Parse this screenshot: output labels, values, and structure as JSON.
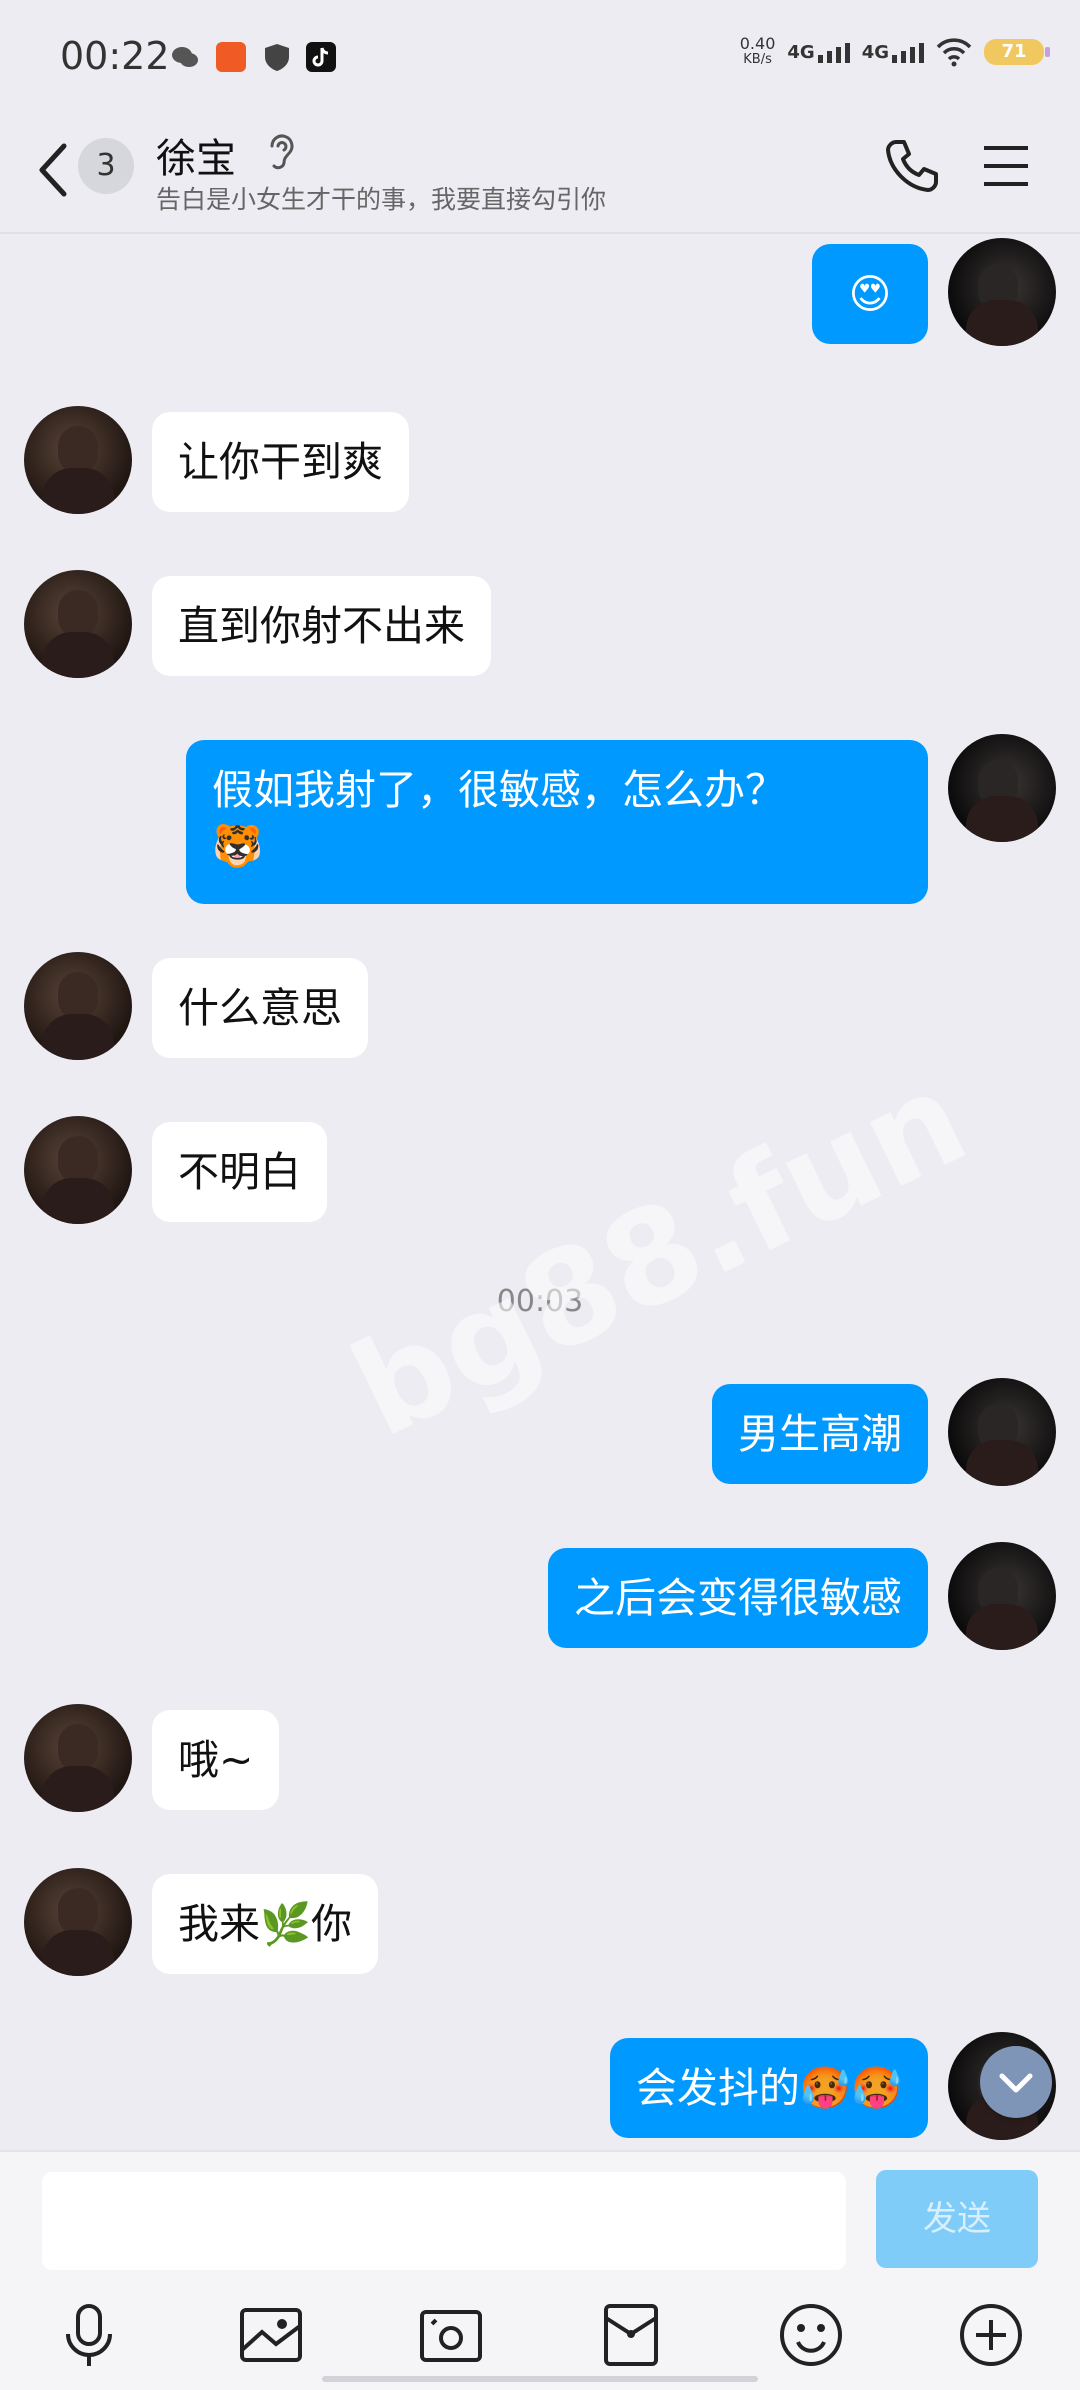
{
  "status": {
    "time": "00:22",
    "net_speed": "0.40",
    "net_unit": "KB/s",
    "net1": "4G",
    "net2": "4G",
    "battery": "71"
  },
  "header": {
    "unread": "3",
    "name": "徐宝",
    "signature": "告白是小女生才干的事，我要直接勾引你"
  },
  "messages": [
    {
      "side": "out",
      "text": "😍"
    },
    {
      "side": "in",
      "text": "让你干到爽"
    },
    {
      "side": "in",
      "text": "直到你射不出来"
    },
    {
      "side": "out",
      "text": "假如我射了，很敏感，怎么办？",
      "text2": "🐯"
    },
    {
      "side": "in",
      "text": "什么意思"
    },
    {
      "side": "in",
      "text": "不明白"
    },
    {
      "side": "out",
      "text": "男生高潮"
    },
    {
      "side": "out",
      "text": "之后会变得很敏感"
    },
    {
      "side": "in",
      "text": "哦~"
    },
    {
      "side": "in",
      "text": "我来🌿你"
    },
    {
      "side": "out",
      "text": "会发抖的🥵🥵"
    }
  ],
  "timestamp": "00:03",
  "watermark": "bg88.fun",
  "input": {
    "send_label": "发送"
  },
  "toolbar": {
    "icons": [
      "microphone-icon",
      "image-icon",
      "camera-icon",
      "red-packet-icon",
      "emoji-icon",
      "plus-icon"
    ]
  },
  "colors": {
    "outgoing_bubble": "#0099ff",
    "incoming_bubble": "#ffffff",
    "send_button": "#7fccf9",
    "background": "#ececf2"
  }
}
